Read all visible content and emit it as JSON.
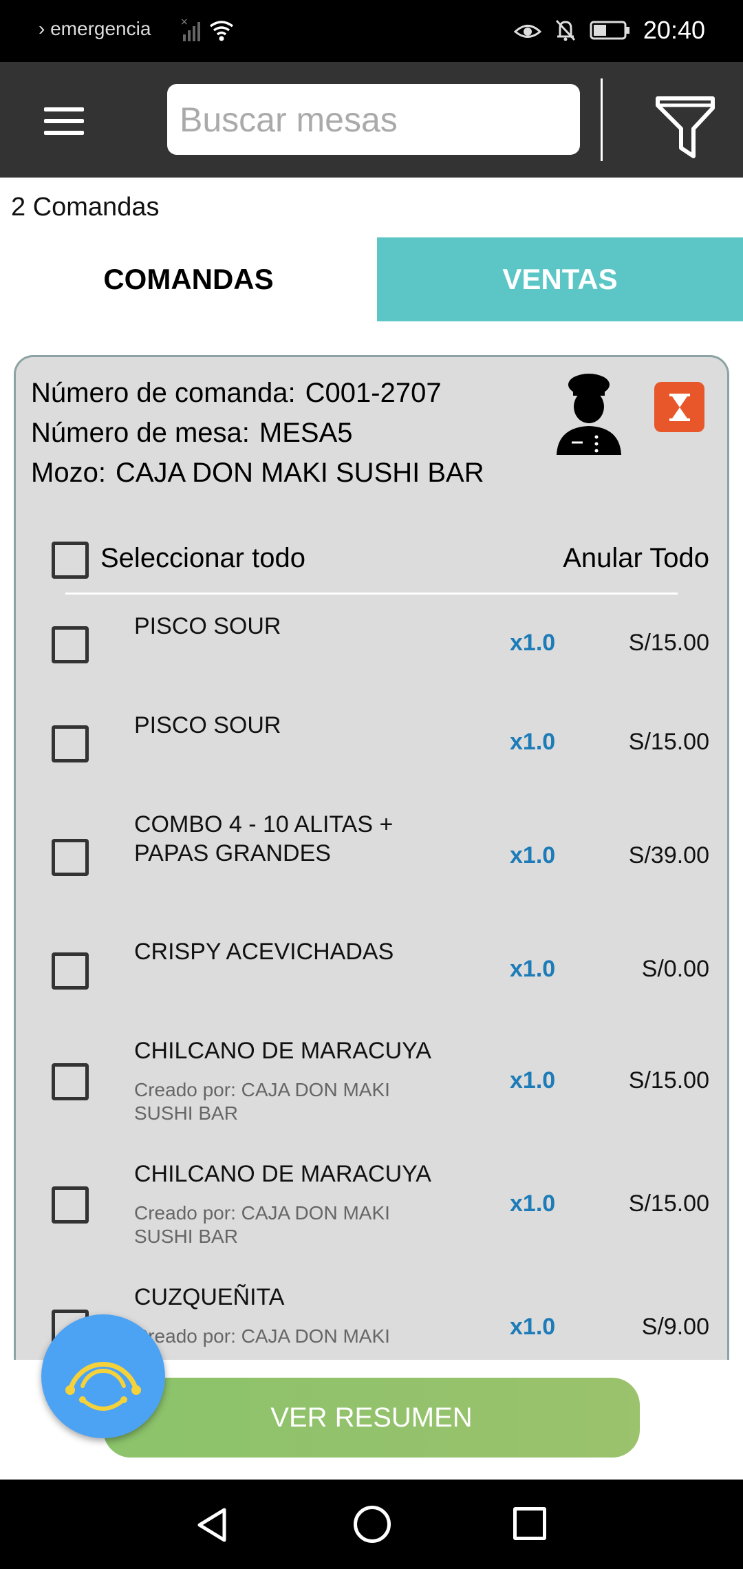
{
  "status_bar": {
    "carrier": "› emergencia",
    "time": "20:40"
  },
  "header": {
    "search_placeholder": "Buscar mesas"
  },
  "comandas_count": "2 Comandas",
  "tabs": [
    {
      "label": "COMANDAS",
      "active": true
    },
    {
      "label": "VENTAS",
      "active": false,
      "color": "#5cc6c6"
    }
  ],
  "order": {
    "numero_comanda_label": "Número de comanda:",
    "numero_comanda": "C001-2707",
    "numero_mesa_label": "Número de mesa:",
    "numero_mesa": "MESA5",
    "mozo_label": "Mozo:",
    "mozo": "CAJA DON MAKI SUSHI BAR",
    "select_all_label": "Seleccionar todo",
    "anular_todo_label": "Anular Todo",
    "items": [
      {
        "name": "PISCO SOUR",
        "created_by": "",
        "qty": "x1.0",
        "price": "S/15.00"
      },
      {
        "name": "PISCO SOUR",
        "created_by": "",
        "qty": "x1.0",
        "price": "S/15.00"
      },
      {
        "name": "COMBO 4 - 10 ALITAS + PAPAS GRANDES",
        "created_by": "",
        "qty": "x1.0",
        "price": "S/39.00"
      },
      {
        "name": "CRISPY ACEVICHADAS",
        "created_by": "",
        "qty": "x1.0",
        "price": "S/0.00"
      },
      {
        "name": "CHILCANO DE MARACUYA",
        "created_by": "Creado por: CAJA DON MAKI SUSHI BAR",
        "qty": "x1.0",
        "price": "S/15.00"
      },
      {
        "name": "CHILCANO DE MARACUYA",
        "created_by": "Creado por: CAJA DON MAKI SUSHI BAR",
        "qty": "x1.0",
        "price": "S/15.00"
      },
      {
        "name": "CUZQUEÑITA",
        "created_by": "Creado por: CAJA DON MAKI",
        "qty": "x1.0",
        "price": "S/9.00"
      }
    ]
  },
  "summary_button_label": "VER RESUMEN",
  "colors": {
    "appbar": "#333333",
    "accent_teal": "#5cc6c6",
    "qty_blue": "#1d7bb8",
    "summary_green": "#8bc36b",
    "timer_orange": "#e8572a",
    "fab_blue": "#4da3f3"
  }
}
